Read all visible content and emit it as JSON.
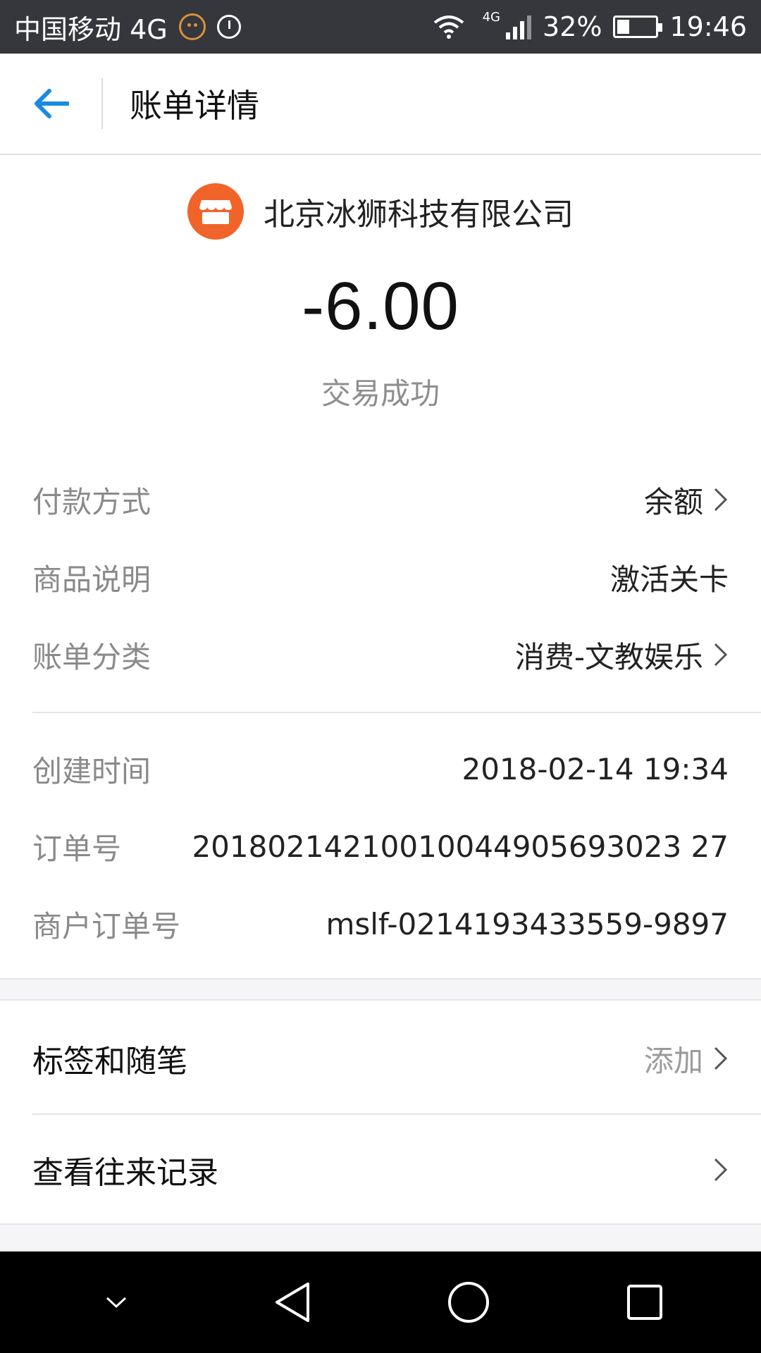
{
  "status_bar": {
    "carrier": "中国移动 4G",
    "network_badge": "4G",
    "battery": "32%",
    "battery_level": 0.32,
    "time": "19:46"
  },
  "header": {
    "title": "账单详情"
  },
  "summary": {
    "merchant": "北京冰狮科技有限公司",
    "amount": "-6.00",
    "status": "交易成功"
  },
  "details": [
    {
      "label": "付款方式",
      "value": "余额"
    },
    {
      "label": "商品说明",
      "value": "激活关卡"
    },
    {
      "label": "账单分类",
      "value": "消费-文教娱乐"
    },
    {
      "label": "创建时间",
      "value": "2018-02-14 19:34"
    },
    {
      "label": "订单号",
      "value": "20180214210010044905693023 27"
    },
    {
      "label": "商户订单号",
      "value": "mslf-0214193433559-9897"
    }
  ],
  "actions": {
    "tags_label": "标签和随笔",
    "tags_action": "添加",
    "history_label": "查看往来记录"
  },
  "colors": {
    "accent": "#1a8be0",
    "merchant_logo": "#f0642a",
    "status_bar": "#35373c"
  }
}
